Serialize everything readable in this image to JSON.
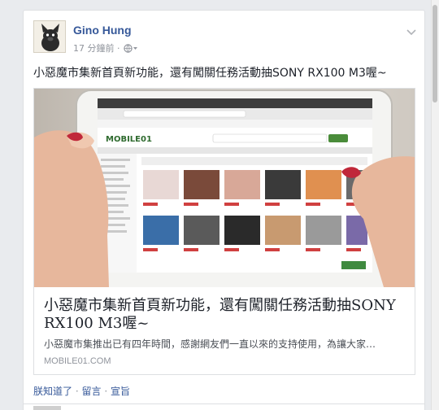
{
  "post": {
    "author": "Gino Hung",
    "timestamp": "17 分鐘前 ·",
    "audience_icon": "globe-icon",
    "text": "小惡魔市集新首頁新功能，還有闖關任務活動抽SONY RX100 M3喔~"
  },
  "link": {
    "image_icon": "tablet-photo",
    "title": "小惡魔市集新首頁新功能，還有闖關任務活動抽SONY RX100 M3喔~",
    "description": "小惡魔市集推出已有四年時間，感謝網友們一直以來的支持使用，為讓大家…",
    "domain": "MOBILE01.COM"
  },
  "actions": {
    "like": "朕知道了",
    "comment": "留言",
    "share": "宣旨",
    "separator": "·"
  },
  "colors": {
    "link_blue": "#365899",
    "meta_gray": "#90949c",
    "text": "#1d2129",
    "background": "#e9ebee"
  }
}
